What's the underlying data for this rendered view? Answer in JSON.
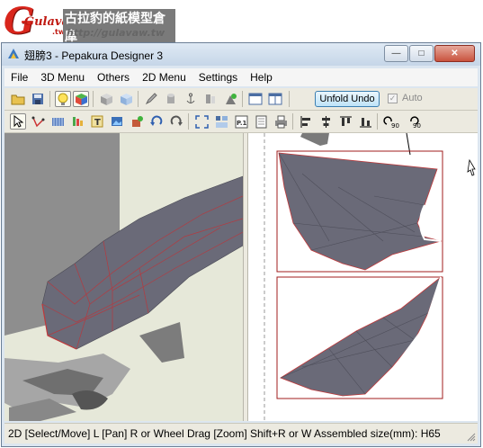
{
  "watermark": {
    "logo": "Gulavaw",
    "logo_suffix": ".tw",
    "chinese_text": "古拉豹的紙模型倉庫",
    "url": "http://gulavaw.tw"
  },
  "window": {
    "title": "翅膀3 - Pepakura Designer 3",
    "minimize": "—",
    "maximize": "□",
    "close": "✕"
  },
  "menu": [
    {
      "label": "File",
      "name": "menu-file"
    },
    {
      "label": "3D Menu",
      "name": "menu-3d"
    },
    {
      "label": "Others",
      "name": "menu-others"
    },
    {
      "label": "2D Menu",
      "name": "menu-2d"
    },
    {
      "label": "Settings",
      "name": "menu-settings"
    },
    {
      "label": "Help",
      "name": "menu-help"
    }
  ],
  "toolbar": {
    "unfold_undo": "Unfold Undo",
    "auto_label": "Auto",
    "auto_checked": true
  },
  "status": {
    "text": "2D [Select/Move] L [Pan] R or Wheel Drag [Zoom] Shift+R or W Assembled size(mm): H65"
  },
  "colors": {
    "accent": "#3c7fb1",
    "part_fill": "#6a6a78",
    "cut_line": "#c0393b",
    "page_border": "#a01c1c"
  }
}
